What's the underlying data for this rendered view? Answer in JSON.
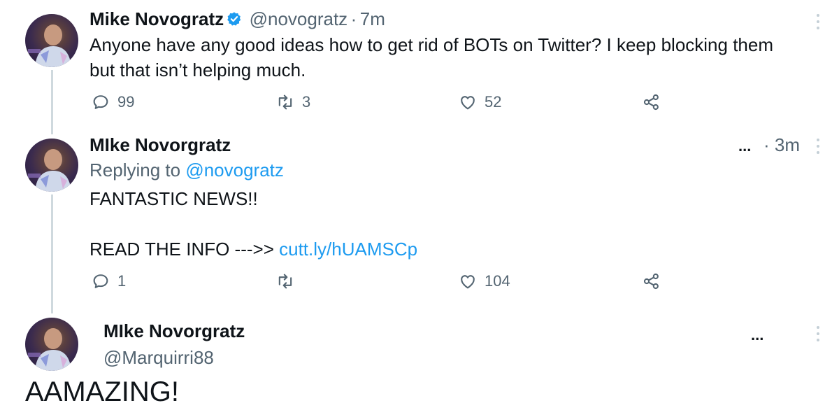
{
  "tweets": [
    {
      "name": "Mike Novogratz",
      "verified": true,
      "handle": "@novogratz",
      "separator": "·",
      "time": "7m",
      "text_line1": "Anyone have any good ideas how to get rid of BOTs on Twitter? I keep blocking them",
      "text_line2": "but that isn’t helping much.",
      "actions": {
        "replies": "99",
        "retweets": "3",
        "likes": "52"
      }
    },
    {
      "name": "MIke Novorgratz",
      "more": "...",
      "time_prefix": "·",
      "time": "3m",
      "replying_label": "Replying to",
      "replying_handle": "@novogratz",
      "line1": "FANTASTIC NEWS!!",
      "line2_prefix": "READ THE INFO --->>",
      "link": "cutt.ly/hUAMSCp",
      "actions": {
        "replies": "1",
        "retweets": "",
        "likes": "104"
      }
    },
    {
      "name": "MIke Novorgratz",
      "handle": "@Marquirri88",
      "more": "...",
      "text": "AAMAZING!"
    }
  ],
  "colors": {
    "text": "#0f1419",
    "secondary": "#536471",
    "link": "#1d9bf0",
    "verified": "#1d9bf0",
    "thread_line": "#cfd9de"
  },
  "icons": {
    "reply": "speech-bubble-icon",
    "retweet": "retweet-icon",
    "like": "heart-icon",
    "share": "share-icon",
    "verified": "verified-badge-icon",
    "more": "more-dots-icon"
  }
}
